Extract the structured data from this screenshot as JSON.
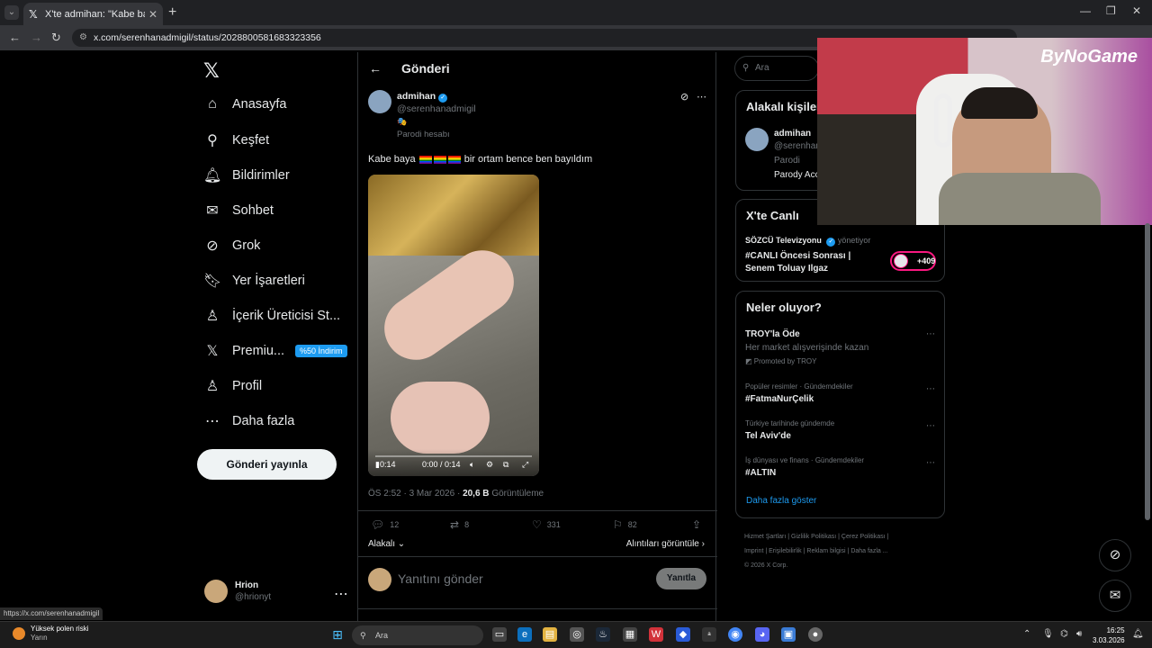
{
  "browser": {
    "tab_title": "X'te admihan: \"Kabe baya",
    "url": "x.com/serenhanadmigil/status/2028800581683323356",
    "status_url": "https://x.com/serenhanadmigil"
  },
  "leftnav": {
    "items": [
      {
        "label": "Anasayfa",
        "icon": "home-icon"
      },
      {
        "label": "Keşfet",
        "icon": "search-icon"
      },
      {
        "label": "Bildirimler",
        "icon": "bell-icon"
      },
      {
        "label": "Sohbet",
        "icon": "mail-icon"
      },
      {
        "label": "Grok",
        "icon": "grok-icon"
      },
      {
        "label": "Yer İşaretleri",
        "icon": "bookmark-icon"
      },
      {
        "label": "İçerik Üreticisi St...",
        "icon": "creator-icon"
      },
      {
        "label": "Premiu...",
        "icon": "x-icon"
      },
      {
        "label": "Profil",
        "icon": "person-icon"
      },
      {
        "label": "Daha fazla",
        "icon": "more-icon"
      }
    ],
    "promo_badge": "%50 İndirim",
    "post_button": "Gönderi yayınla",
    "user": {
      "name": "Hrion",
      "handle": "@hrionyt"
    }
  },
  "post": {
    "header": "Gönderi",
    "author": "admihan",
    "handle": "@serenhanadmigil",
    "mask": "🎭",
    "parody_label": "Parodi hesabı",
    "text_before": "Kabe baya",
    "text_after": "bir ortam bence ben bayıldım",
    "video": {
      "badge": "0:14",
      "time": "0:00 / 0:14"
    },
    "timestamp": "ÖS 2:52 · 3 Mar 2026 ·",
    "views": "20,6 B",
    "views_label": "Görüntüleme",
    "replies": "12",
    "reposts": "8",
    "likes": "331",
    "bookmarks": "82",
    "related": "Alakalı",
    "quotes": "Alıntıları görüntüle",
    "reply_placeholder": "Yanıtını gönder",
    "reply_button": "Yanıtla"
  },
  "right": {
    "search_placeholder": "Ara",
    "related_people": {
      "title": "Alakalı kişiler",
      "name": "admihan",
      "handle": "@serenhan",
      "parody": "Parodi",
      "bio": "Parody Acc"
    },
    "live": {
      "title": "X'te Canlı",
      "host": "SÖZCÜ Televizyonu",
      "role": "yönetiyor",
      "line1": "#CANLI Öncesi Sonrası |",
      "line2": "Senem Toluay Ilgaz",
      "count": "+409"
    },
    "trends": {
      "title": "Neler oluyor?",
      "items": [
        {
          "context": "",
          "name": "TROY'la Öde",
          "sub": "Her market alışverişinde kazan",
          "promoted": "Promoted by TROY"
        },
        {
          "context": "Popüler resimler · Gündemdekiler",
          "name": "#FatmaNurÇelik"
        },
        {
          "context": "Türkiye tarihinde gündemde",
          "name": "Tel Aviv'de"
        },
        {
          "context": "İş dünyası ve finans · Gündemdekiler",
          "name": "#ALTIN"
        }
      ],
      "show_more": "Daha fazla göster"
    },
    "footer": [
      "Hizmet Şartları",
      "Gizlilik Politikası",
      "Çerez Politikası",
      "Imprint",
      "Erişilebilirlik",
      "Reklam bilgisi",
      "Daha fazla ...",
      "© 2026 X Corp."
    ]
  },
  "overlay": {
    "brand": "ByNoGame"
  },
  "taskbar": {
    "weather_title": "Yüksek polen riski",
    "weather_sub": "Yarın",
    "search": "Ara",
    "time": "16:25",
    "date": "3.03.2026"
  }
}
